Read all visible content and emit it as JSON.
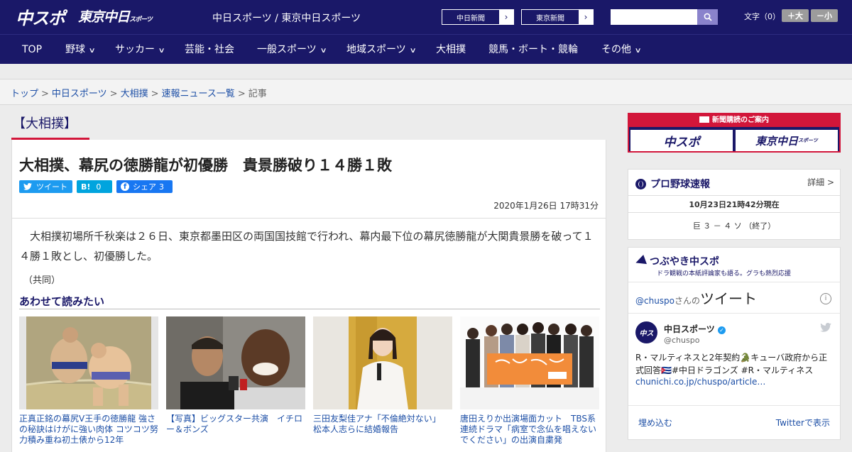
{
  "header": {
    "logo_primary": "中スポ",
    "logo_secondary": "東京中日",
    "logo_secondary_small": "スポーツ",
    "site_name": "中日スポーツ / 東京中日スポーツ",
    "ext_links": [
      "中日新聞",
      "東京新聞"
    ],
    "search_placeholder": "",
    "font_label": "文字（0）",
    "font_bigger": "＋大",
    "font_smaller": "－小"
  },
  "nav": {
    "items": [
      {
        "label": "TOP",
        "chevron": false
      },
      {
        "label": "野球",
        "chevron": true
      },
      {
        "label": "サッカー",
        "chevron": true
      },
      {
        "label": "芸能・社会",
        "chevron": false
      },
      {
        "label": "一般スポーツ",
        "chevron": true
      },
      {
        "label": "地域スポーツ",
        "chevron": true
      },
      {
        "label": "大相撲",
        "chevron": false
      },
      {
        "label": "競馬・ボート・競輪",
        "chevron": false
      },
      {
        "label": "その他",
        "chevron": true
      }
    ]
  },
  "breadcrumb": {
    "links": [
      "トップ",
      "中日スポーツ",
      "大相撲",
      "速報ニュース一覧"
    ],
    "current": "記事",
    "separator": ">"
  },
  "category": "【大相撲】",
  "article": {
    "title": "大相撲、幕尻の徳勝龍が初優勝　貴景勝破り１４勝１敗",
    "share": {
      "tweet": "ツイート",
      "hatena_label": "B!",
      "hatena_count": "0",
      "facebook": "シェア",
      "facebook_count": "3"
    },
    "date": "2020年1月26日 17時31分",
    "body": "大相撲初場所千秋楽は２６日、東京都墨田区の両国国技館で行われ、幕内最下位の幕尻徳勝龍が大関貴景勝を破って１４勝１敗とし、初優勝した。",
    "credit": "（共同）"
  },
  "related": {
    "title": "あわせて読みたい",
    "items": [
      {
        "caption": "正真正銘の幕尻V王手の徳勝龍 強さの秘訣はけがに強い肉体 コツコツ努力積み重ね初土俵から12年"
      },
      {
        "caption": "【写真】ビッグスター共演　イチロー＆ボンズ"
      },
      {
        "caption": "三田友梨佳アナ「不倫絶対ない」　松本人志らに結婚報告"
      },
      {
        "caption": "唐田えりか出演場面カット　TBS系連続ドラマ「病室で念仏を唱えないでください」の出演自粛発"
      }
    ]
  },
  "sidebar": {
    "ad": {
      "header": "新聞購読のご案内",
      "left": "中スポ",
      "right": "東京中日",
      "right_small": "スポーツ"
    },
    "baseball": {
      "title": "プロ野球速報",
      "detail": "詳細 >",
      "timestamp": "10月23日21時42分現在",
      "score": "巨 ３ － ４ ソ （終了）"
    },
    "twitter": {
      "title": "つぶやき中スポ",
      "subtitle": "ドラ観戦の本紙評論家も語る。グラも熱烈応援",
      "handle_link": "@chuspo",
      "handle_suffix": "さんの",
      "tweets_label": "ツイート",
      "author": "中日スポーツ",
      "author_handle": "@chuspo",
      "tweet_text": "R・マルティネスと2年契約🐊キューバ政府から正式回答🇨🇺#中日ドラゴンズ #R・マルティネス",
      "tweet_link": "chunichi.co.jp/chuspo/article…",
      "embed": "埋め込む",
      "view_on": "Twitterで表示"
    }
  },
  "colors": {
    "navy": "#1a1868",
    "red": "#d2163a",
    "link": "#1d4fa6",
    "twitter": "#1d9bf0",
    "facebook": "#1877f2",
    "hatena": "#00a4de"
  }
}
